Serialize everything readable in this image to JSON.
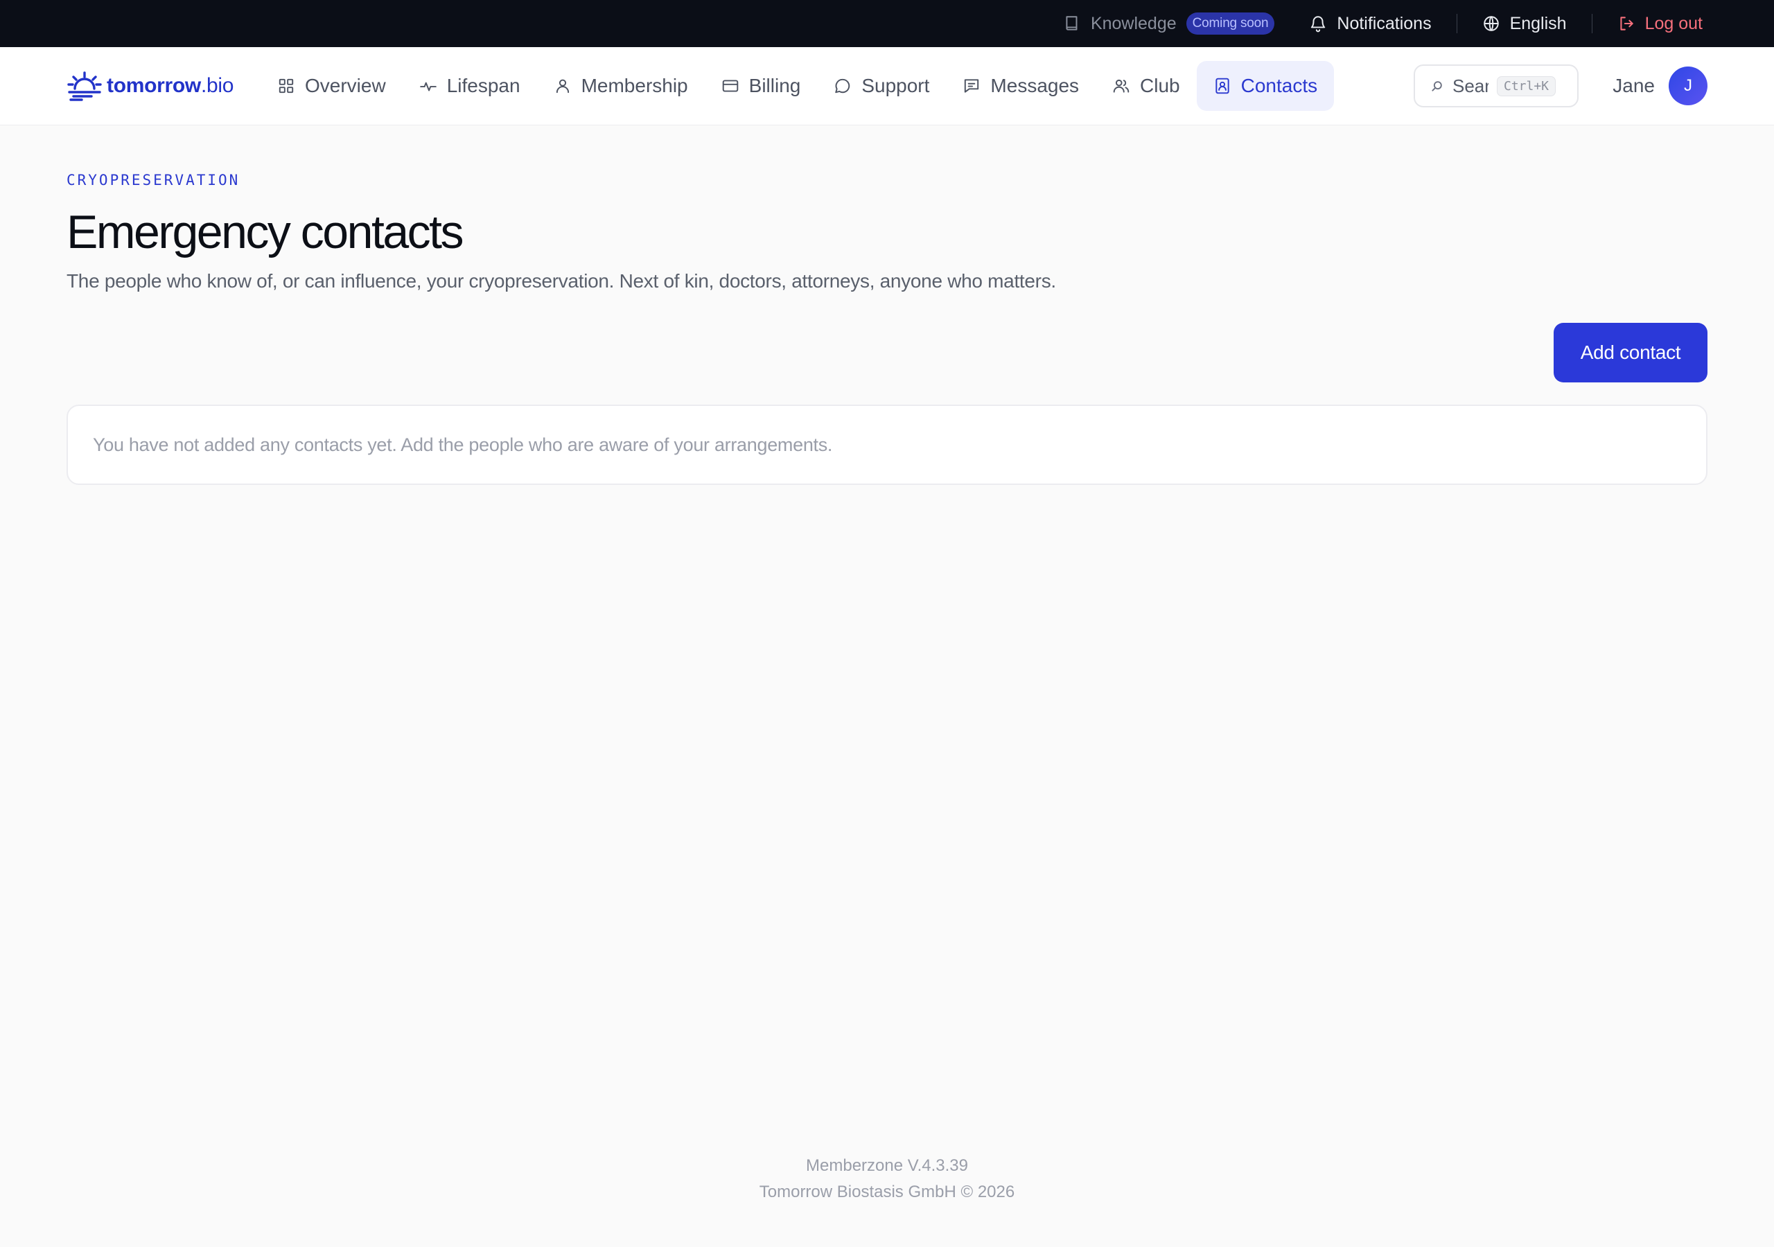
{
  "topbar": {
    "knowledge_label": "Knowledge",
    "knowledge_badge": "Coming soon",
    "notifications_label": "Notifications",
    "language_label": "English",
    "logout_label": "Log out"
  },
  "brand": {
    "name_bold": "tomorrow",
    "name_suffix": ".bio",
    "color": "#2233c9"
  },
  "nav": {
    "items": [
      {
        "label": "Overview",
        "icon": "grid-icon"
      },
      {
        "label": "Lifespan",
        "icon": "pulse-icon"
      },
      {
        "label": "Membership",
        "icon": "user-icon"
      },
      {
        "label": "Billing",
        "icon": "credit-card-icon"
      },
      {
        "label": "Support",
        "icon": "chat-bubble-icon"
      },
      {
        "label": "Messages",
        "icon": "message-square-icon"
      },
      {
        "label": "Club",
        "icon": "users-icon"
      },
      {
        "label": "Contacts",
        "icon": "contact-card-icon",
        "active": true
      }
    ]
  },
  "search": {
    "placeholder": "Sear",
    "shortcut": "Ctrl+K"
  },
  "user": {
    "name": "Jane",
    "initial": "J"
  },
  "page": {
    "eyebrow": "CRYOPRESERVATION",
    "title": "Emergency contacts",
    "subtitle": "The people who know of, or can influence, your cryopreservation. Next of kin, doctors, attorneys, anyone who matters.",
    "add_button": "Add contact",
    "empty_message": "You have not added any contacts yet. Add the people who are aware of your arrangements."
  },
  "footer": {
    "version": "Memberzone V.4.3.39",
    "copyright": "Tomorrow Biostasis GmbH © 2026"
  },
  "colors": {
    "accent": "#2b39d9",
    "topbar_bg": "#0b0e17",
    "logout": "#f6707c",
    "badge_bg": "#2b34a8"
  }
}
